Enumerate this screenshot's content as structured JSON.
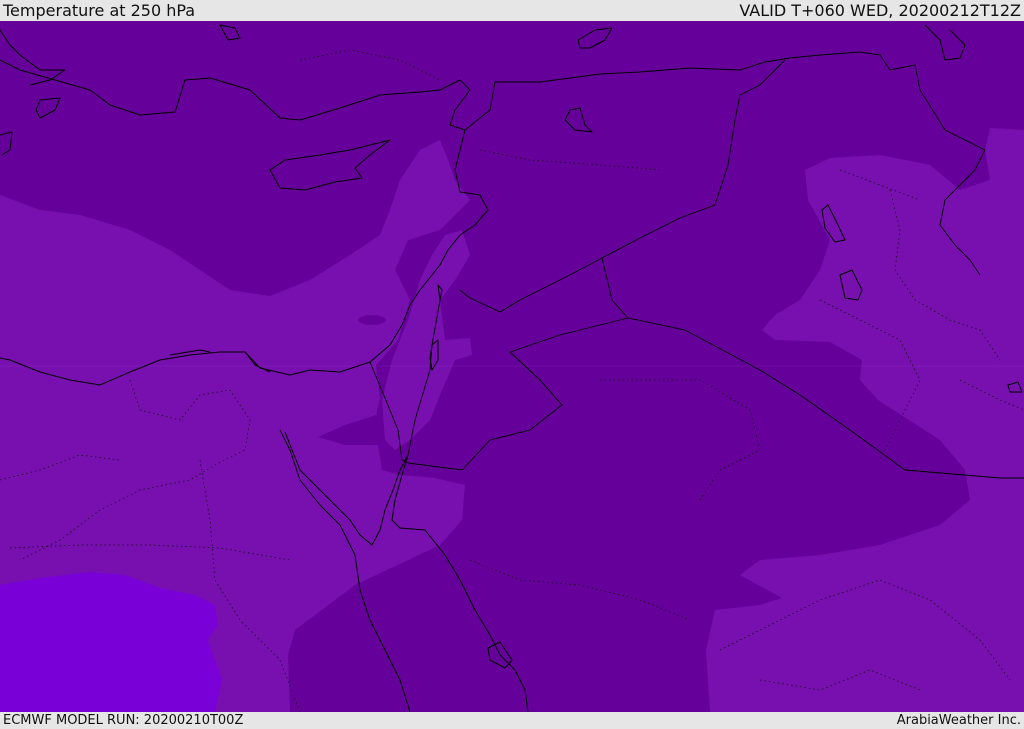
{
  "header": {
    "title": "Temperature at 250 hPa",
    "valid_time": "VALID T+060 WED, 20200212T12Z"
  },
  "footer": {
    "model_run": "ECMWF MODEL RUN: 20200210T00Z",
    "credit": "ArabiaWeather Inc."
  },
  "map": {
    "colors": {
      "cold_band": "#66009a",
      "mid_band": "#7810b0",
      "warm_band": "#7a00d8",
      "coastline": "#000000"
    }
  }
}
